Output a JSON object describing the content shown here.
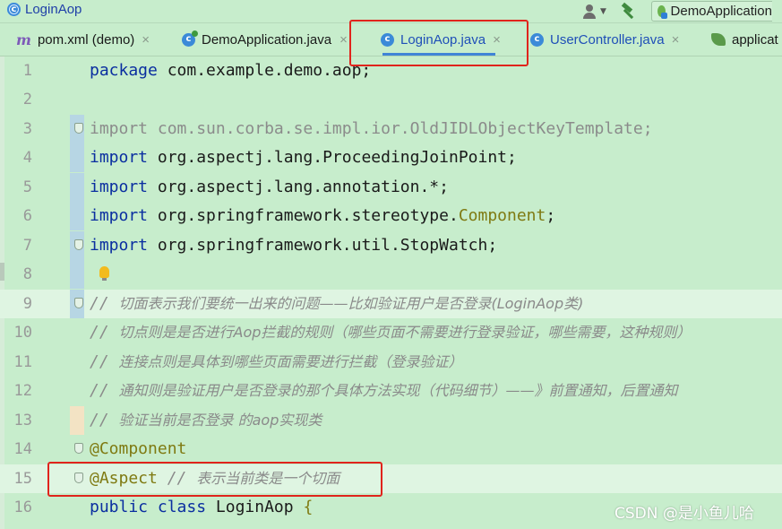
{
  "window": {
    "file_title": "LoginAop",
    "run_config": "DemoApplication"
  },
  "tabs": [
    {
      "label": "pom.xml (demo)",
      "icon": "maven-icon"
    },
    {
      "label": "DemoApplication.java",
      "icon": "class-icon"
    },
    {
      "label": "LoginAop.java",
      "icon": "class-icon",
      "active": true
    },
    {
      "label": "UserController.java",
      "icon": "class-icon"
    },
    {
      "label": "applicat",
      "icon": "spring-config-icon"
    }
  ],
  "close_glyph": "×",
  "editor": {
    "line_numbers": [
      "1",
      "2",
      "3",
      "4",
      "5",
      "6",
      "7",
      "8",
      "9",
      "10",
      "11",
      "12",
      "13",
      "14",
      "15",
      "16"
    ],
    "line1": {
      "kw": "package",
      "rest": " com.example.demo.aop;"
    },
    "line3": {
      "kw": "import",
      "rest": " com.sun.corba.se.impl.ior.OldJIDLObjectKeyTemplate;"
    },
    "line4": {
      "kw": "import",
      "rest": " org.aspectj.lang.ProceedingJoinPoint;"
    },
    "line5": {
      "kw": "import",
      "rest": " org.aspectj.lang.annotation.*;"
    },
    "line6": {
      "kw": "import",
      "rest": " org.springframework.stereotype.",
      "cls": "Component",
      "end": ";"
    },
    "line7": {
      "kw": "import",
      "rest": " org.springframework.util.StopWatch;"
    },
    "line9": {
      "slashes": "// ",
      "text": "切面表示我们要统一出来的问题——比如验证用户是否登录(LoginAop类)"
    },
    "line10": {
      "slashes": "// ",
      "text": "切点则是是否进行Aop拦截的规则（哪些页面不需要进行登录验证，哪些需要，这种规则）"
    },
    "line11": {
      "slashes": "// ",
      "text": "连接点则是具体到哪些页面需要进行拦截（登录验证）"
    },
    "line12": {
      "slashes": "// ",
      "text": "通知则是验证用户是否登录的那个具体方法实现（代码细节）——》前置通知，后置通知"
    },
    "line13": {
      "slashes": "// ",
      "text": "验证当前是否登录 的aop实现类"
    },
    "line14": {
      "ann": "@Component"
    },
    "line15": {
      "ann": "@Aspect",
      "comment_slashes": " // ",
      "comment": "表示当前类是一个切面"
    },
    "line16": {
      "kw1": "public",
      "kw2": "class",
      "name": " LoginAop ",
      "brace": "{"
    }
  },
  "watermark": "CSDN @是小鱼儿哈",
  "colors": {
    "background": "#c7edcc",
    "keyword": "#0a2ea0",
    "annotation": "#7f7a12",
    "comment": "#8a8a8a",
    "highlight_box": "#e0241c",
    "active_tab_underline": "#4084d6"
  }
}
